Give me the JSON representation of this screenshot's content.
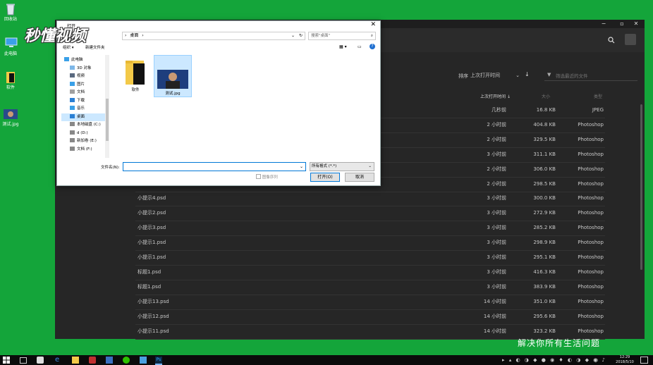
{
  "desktop": {
    "icons": [
      {
        "label": "回收站",
        "icon": "recycle-bin-icon"
      },
      {
        "label": "此电脑",
        "icon": "computer-icon"
      },
      {
        "label": "软件",
        "icon": "folder-icon"
      },
      {
        "label": "测试.jpg",
        "icon": "image-file-icon"
      }
    ],
    "watermark": "秒懂视频",
    "subtitle": "解决你所有生活问题"
  },
  "ps": {
    "sort_label": "排序",
    "sort_value": "上次打开时间",
    "filter_placeholder": "筛选最近的文件",
    "col_time": "上次打开时间",
    "col_size": "大小",
    "col_type": "类型",
    "files": [
      {
        "name": "",
        "time": "几秒前",
        "size": "16.8 KB",
        "type": "JPEG"
      },
      {
        "name": "",
        "time": "2 小时前",
        "size": "404.8 KB",
        "type": "Photoshop"
      },
      {
        "name": "",
        "time": "2 小时前",
        "size": "329.5 KB",
        "type": "Photoshop"
      },
      {
        "name": "",
        "time": "3 小时前",
        "size": "311.1 KB",
        "type": "Photoshop"
      },
      {
        "name": "",
        "time": "2 小时前",
        "size": "306.0 KB",
        "type": "Photoshop"
      },
      {
        "name": "",
        "time": "2 小时前",
        "size": "298.5 KB",
        "type": "Photoshop"
      },
      {
        "name": "小提示4.psd",
        "time": "3 小时前",
        "size": "300.0 KB",
        "type": "Photoshop"
      },
      {
        "name": "小提示2.psd",
        "time": "3 小时前",
        "size": "272.9 KB",
        "type": "Photoshop"
      },
      {
        "name": "小提示3.psd",
        "time": "3 小时前",
        "size": "285.2 KB",
        "type": "Photoshop"
      },
      {
        "name": "小提示1.psd",
        "time": "3 小时前",
        "size": "298.9 KB",
        "type": "Photoshop"
      },
      {
        "name": "小提示1.psd",
        "time": "3 小时前",
        "size": "295.1 KB",
        "type": "Photoshop"
      },
      {
        "name": "标题1.psd",
        "time": "3 小时前",
        "size": "416.3 KB",
        "type": "Photoshop"
      },
      {
        "name": "标题1.psd",
        "time": "3 小时前",
        "size": "383.9 KB",
        "type": "Photoshop"
      },
      {
        "name": "小提示13.psd",
        "time": "14 小时前",
        "size": "351.0 KB",
        "type": "Photoshop"
      },
      {
        "name": "小提示12.psd",
        "time": "14 小时前",
        "size": "295.6 KB",
        "type": "Photoshop"
      },
      {
        "name": "小提示11.psd",
        "time": "14 小时前",
        "size": "323.2 KB",
        "type": "Photoshop"
      }
    ]
  },
  "dialog": {
    "title": "打开",
    "path": "桌面",
    "search_placeholder": "搜索\"桌面\"",
    "organize": "组织 ▾",
    "new_folder": "新建文件夹",
    "nav": [
      {
        "label": "此电脑",
        "icon": "computer-icon"
      },
      {
        "label": "3D 对象",
        "icon": "3d-objects-icon"
      },
      {
        "label": "视频",
        "icon": "video-icon"
      },
      {
        "label": "图片",
        "icon": "pictures-icon"
      },
      {
        "label": "文档",
        "icon": "documents-icon"
      },
      {
        "label": "下载",
        "icon": "download-icon"
      },
      {
        "label": "音乐",
        "icon": "music-icon"
      },
      {
        "label": "桌面",
        "icon": "desktop-icon"
      },
      {
        "label": "本地磁盘 (C:)",
        "icon": "drive-icon"
      },
      {
        "label": "d (D:)",
        "icon": "drive-icon"
      },
      {
        "label": "新加卷 (E:)",
        "icon": "drive-icon"
      },
      {
        "label": "文档 (F:)",
        "icon": "drive-icon"
      }
    ],
    "files": [
      {
        "label": "软件",
        "icon": "folder-icon"
      },
      {
        "label": "测试.jpg",
        "icon": "image-thumbnail-icon"
      }
    ],
    "filename_label": "文件名(N):",
    "filename_value": "",
    "filetype_value": "所有格式 (*.*)",
    "sequence_label": "图像序列",
    "open_button": "打开(O)",
    "cancel_button": "取消"
  },
  "taskbar": {
    "time": "12:29",
    "date": "2018/5/10",
    "ime": "中"
  }
}
